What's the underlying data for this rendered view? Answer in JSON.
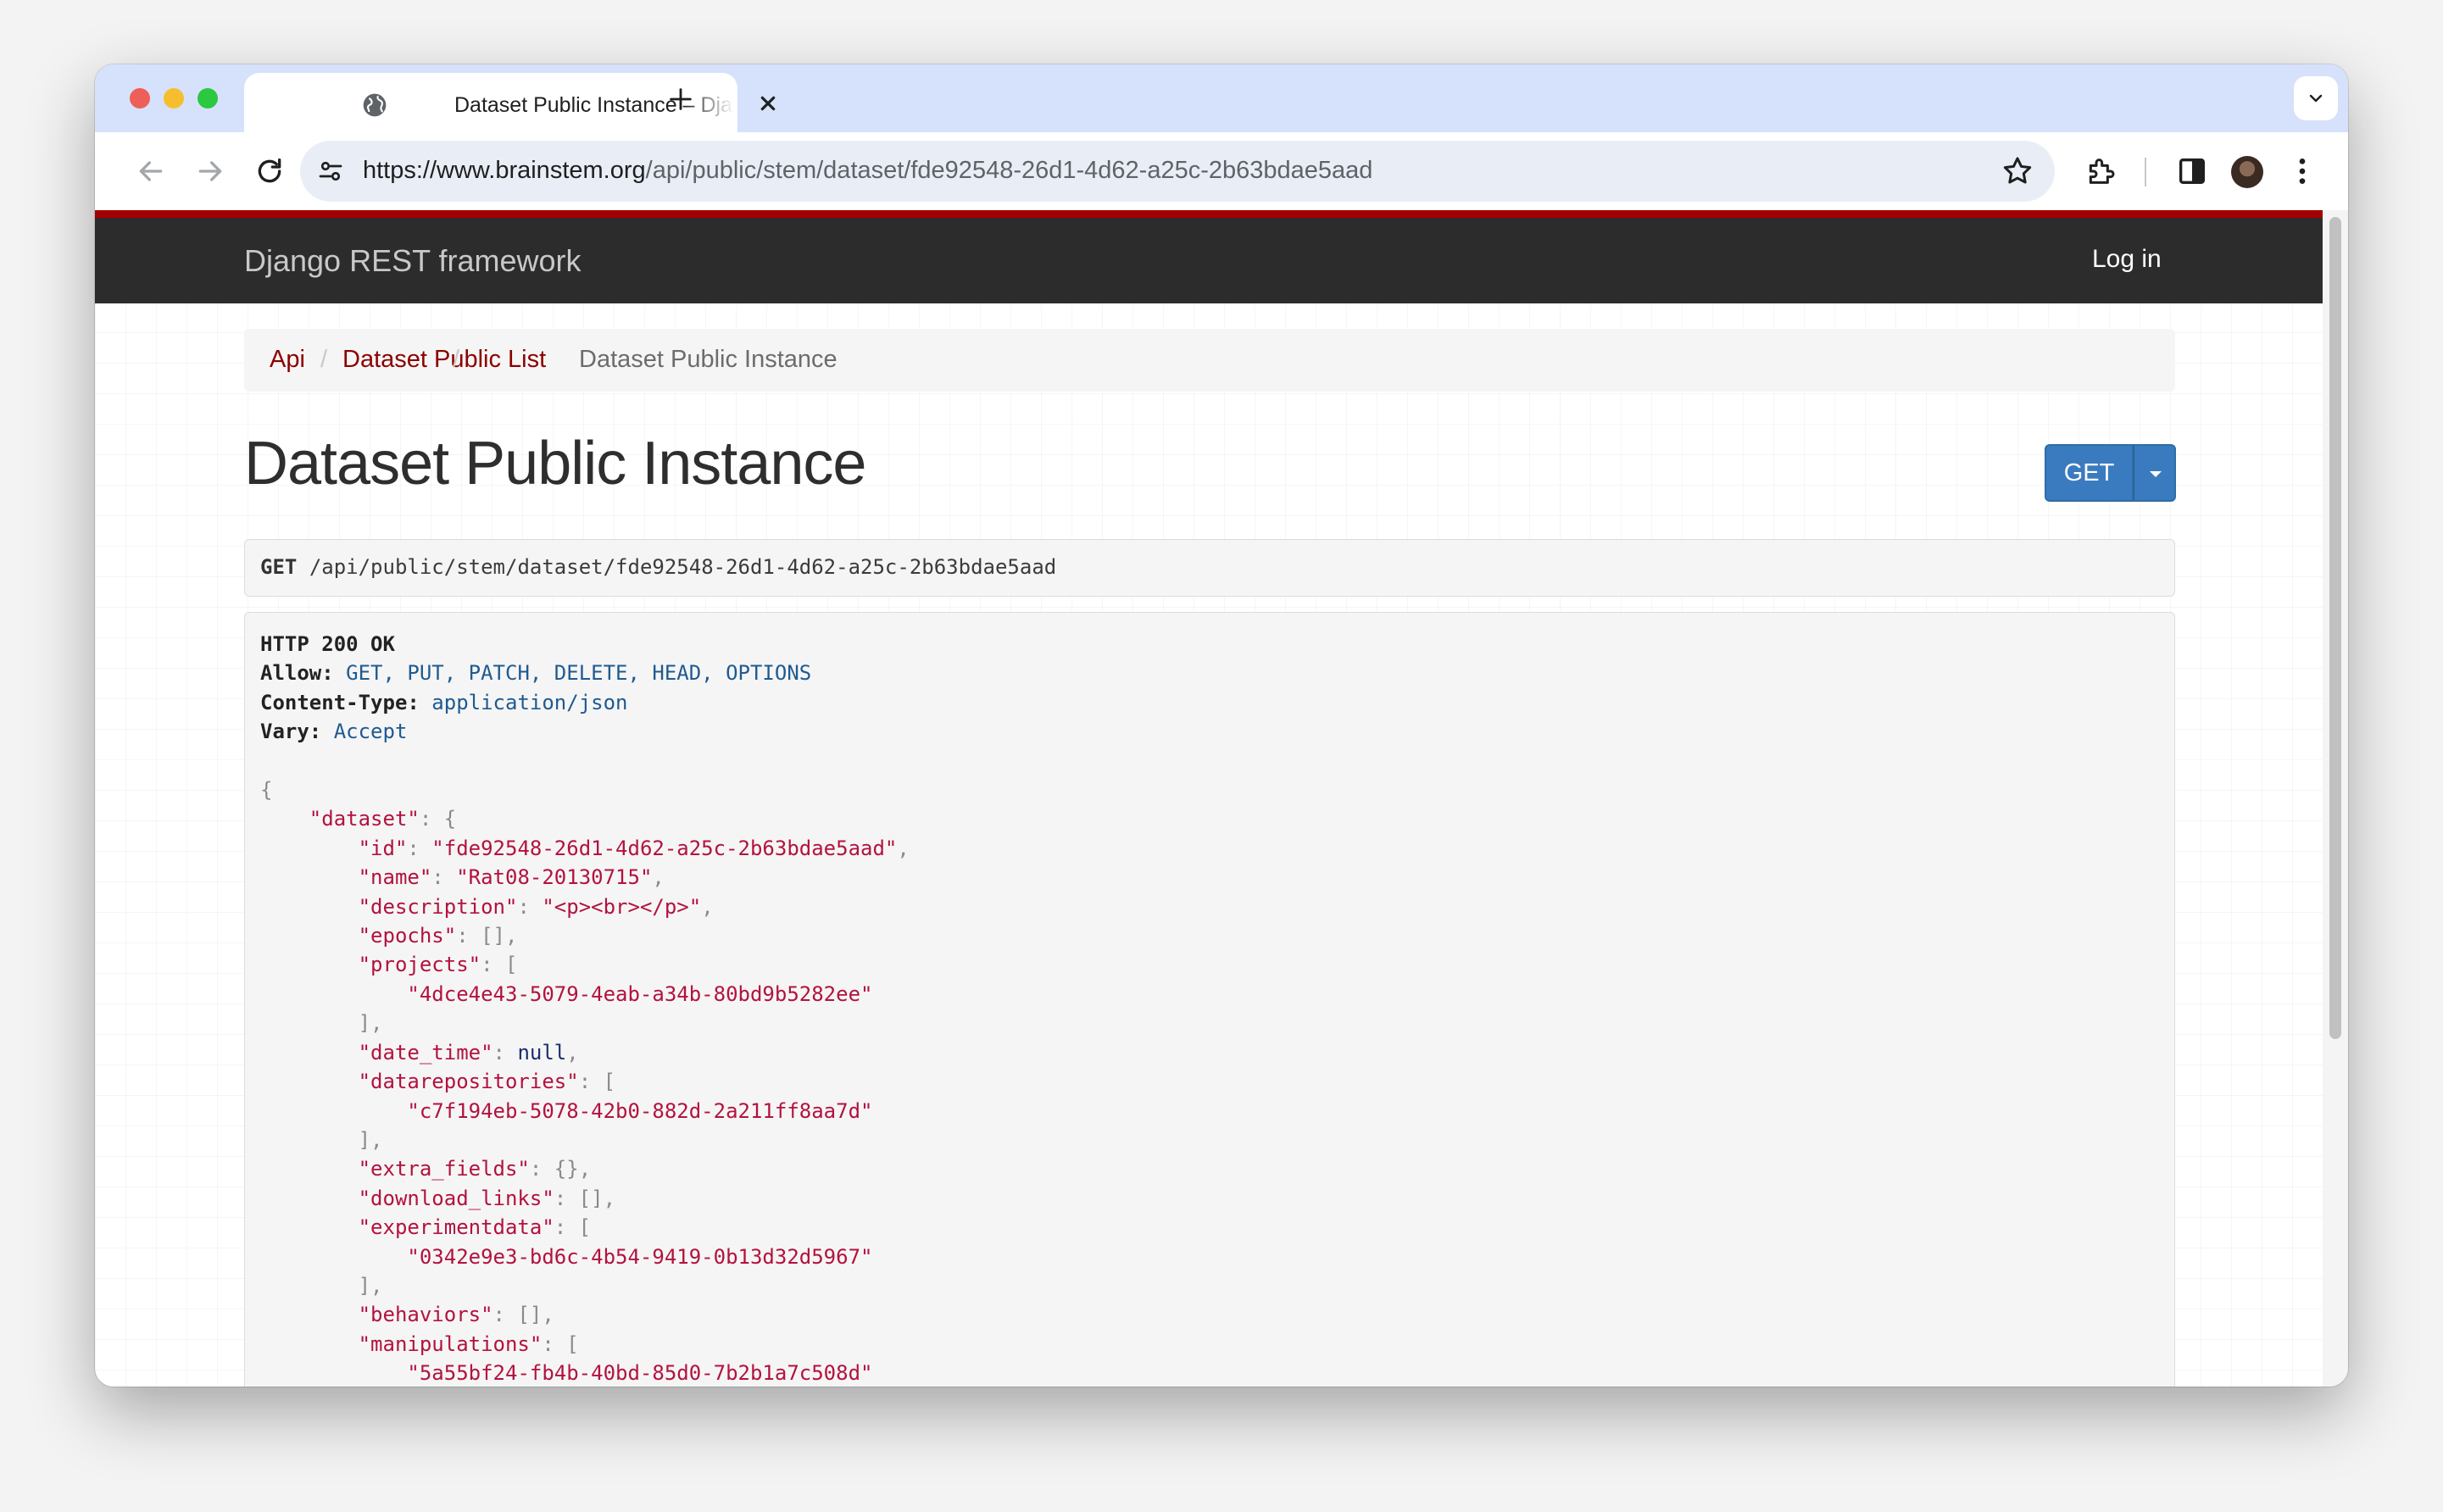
{
  "browser": {
    "tab_title": "Dataset Public Instance – Django REST framework",
    "url_domain": "https://www.brainstem.org",
    "url_path": "/api/public/stem/dataset/fde92548-26d1-4d62-a25c-2b63bdae5aad",
    "colors": {
      "tabstrip": "#d6e2fb",
      "omnibox": "#e9eef6"
    }
  },
  "navbar": {
    "brand": "Django REST framework",
    "login": "Log in",
    "colors": {
      "background": "#2c2c2c",
      "accent": "#a30000"
    }
  },
  "breadcrumb": {
    "items": [
      {
        "label": "Api"
      },
      {
        "label": "Dataset Public List"
      },
      {
        "label": "Dataset Public Instance"
      }
    ],
    "separator": "/"
  },
  "page": {
    "title": "Dataset Public Instance",
    "method_button": "GET"
  },
  "request": {
    "method": "GET",
    "path": "/api/public/stem/dataset/fde92548-26d1-4d62-a25c-2b63bdae5aad"
  },
  "response": {
    "status": "HTTP 200 OK",
    "headers": [
      {
        "name": "Allow:",
        "value": "GET, PUT, PATCH, DELETE, HEAD, OPTIONS"
      },
      {
        "name": "Content-Type:",
        "value": "application/json"
      },
      {
        "name": "Vary:",
        "value": "Accept"
      }
    ],
    "dataset": {
      "id": "fde92548-26d1-4d62-a25c-2b63bdae5aad",
      "name": "Rat08-20130715",
      "description": "<p><br></p>",
      "projects": [
        "4dce4e43-5079-4eab-a34b-80bd9b5282ee"
      ],
      "date_time": "null",
      "datarepositories": [
        "c7f194eb-5078-42b0-882d-2a211ff8aa7d"
      ],
      "experimentdata": [
        "0342e9e3-bd6c-4b54-9419-0b13d32d5967"
      ],
      "manipulations": [
        "5a55bf24-fb4b-40bd-85d0-7b2b1a7c508d"
      ]
    }
  }
}
